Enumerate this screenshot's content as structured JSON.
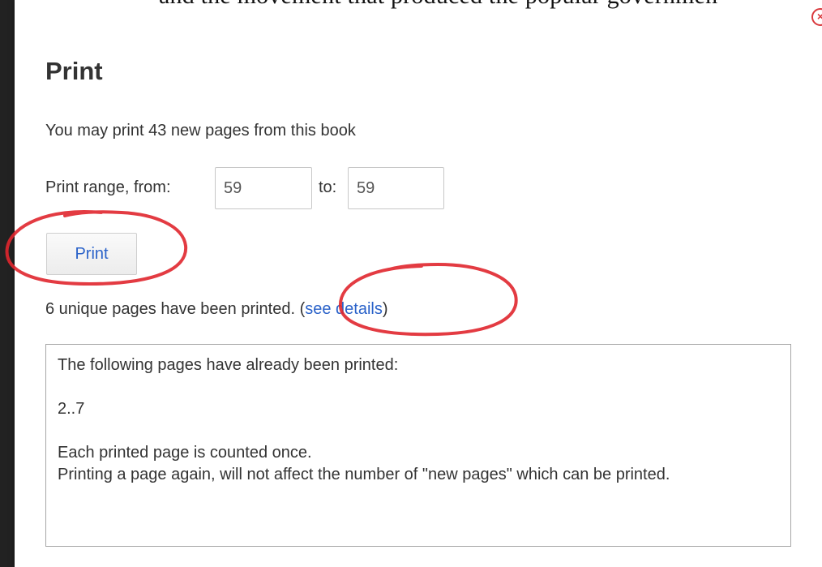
{
  "background": {
    "document_text": "and the movement that produced the popular governmen"
  },
  "dialog": {
    "title": "Print",
    "allowance_text": "You may print 43 new pages from this book",
    "range_label": "Print range, from:",
    "from_value": "59",
    "to_label": "to:",
    "to_value": "59",
    "print_button_label": "Print",
    "status_text": "6 unique pages have been printed. (",
    "details_link": "see details",
    "status_close": ")",
    "close_icon": "close-icon",
    "details": {
      "heading": "The following pages have already been printed:",
      "pages": "2..7",
      "note_1": "Each printed page is counted once.",
      "note_2": "Printing a page again, will not affect the number of \"new pages\" which can be printed."
    }
  },
  "colors": {
    "link": "#2a62c9",
    "annotation": "#e0262e",
    "close": "#d9393d"
  }
}
